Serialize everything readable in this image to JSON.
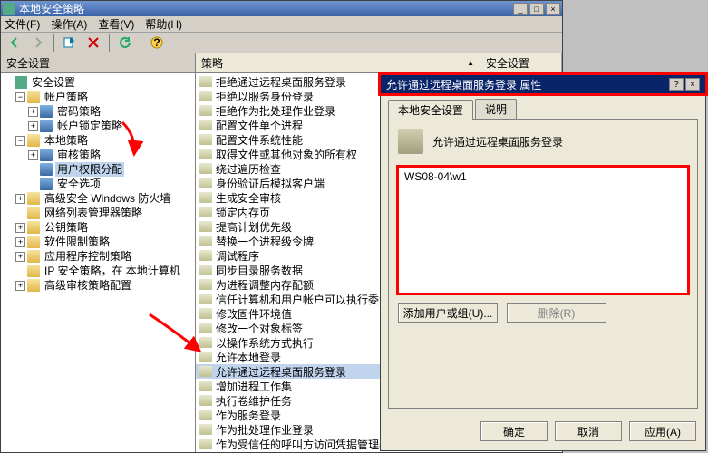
{
  "window": {
    "title": "本地安全策略",
    "menus": {
      "file": "文件(F)",
      "action": "操作(A)",
      "view": "查看(V)",
      "help": "帮助(H)"
    }
  },
  "left_header": "安全设置",
  "tree": {
    "root": "安全设置",
    "account_policy": "帐户策略",
    "password_policy": "密码策略",
    "lockout_policy": "帐户锁定策略",
    "local_policy": "本地策略",
    "audit_policy": "审核策略",
    "user_rights": "用户权限分配",
    "security_options": "安全选项",
    "firewall": "高级安全 Windows 防火墙",
    "netlist": "网络列表管理器策略",
    "pubkey": "公钥策略",
    "software_restrict": "软件限制策略",
    "appctrl": "应用程序控制策略",
    "ipsec": "IP 安全策略，在 本地计算机",
    "advaudit": "高级审核策略配置"
  },
  "columns": {
    "policy": "策略",
    "setting": "安全设置"
  },
  "policies": [
    "拒绝通过远程桌面服务登录",
    "拒绝以服务身份登录",
    "拒绝作为批处理作业登录",
    "配置文件单个进程",
    "配置文件系统性能",
    "取得文件或其他对象的所有权",
    "绕过遍历检查",
    "身份验证后模拟客户端",
    "生成安全审核",
    "锁定内存页",
    "提高计划优先级",
    "替换一个进程级令牌",
    "调试程序",
    "同步目录服务数据",
    "为进程调整内存配额",
    "信任计算机和用户帐户可以执行委派",
    "修改固件环境值",
    "修改一个对象标签",
    "以操作系统方式执行",
    "允许本地登录",
    "允许通过远程桌面服务登录",
    "增加进程工作集",
    "执行卷维护任务",
    "作为服务登录",
    "作为批处理作业登录",
    "作为受信任的呼叫方访问凭据管理器"
  ],
  "selected_policy_index": 20,
  "dialog": {
    "title": "允许通过远程桌面服务登录 属性",
    "tab_local": "本地安全设置",
    "tab_explain": "说明",
    "setting_name": "允许通过远程桌面服务登录",
    "users": [
      "WS08-04\\w1"
    ],
    "add_btn": "添加用户或组(U)...",
    "remove_btn": "删除(R)",
    "ok": "确定",
    "cancel": "取消",
    "apply": "应用(A)"
  }
}
